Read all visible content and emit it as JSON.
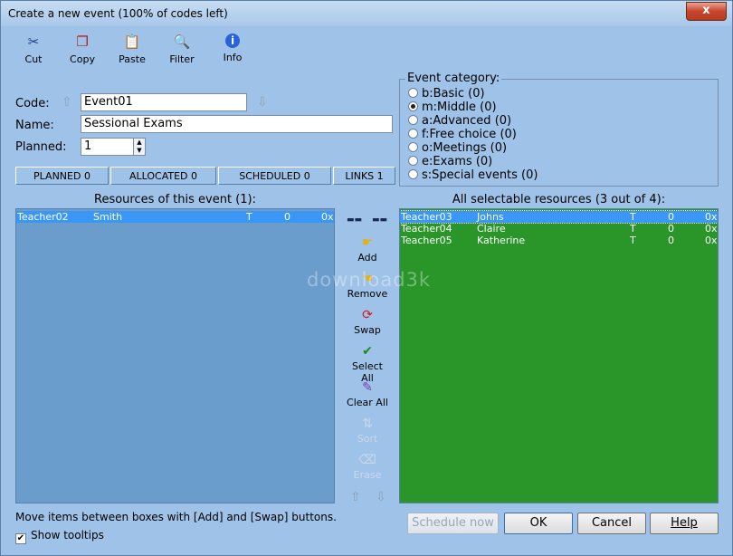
{
  "window": {
    "title": "Create a new event (100% of codes left)",
    "close_label": "x"
  },
  "toolbar": [
    {
      "label": "Cut",
      "icon": "cut-icon"
    },
    {
      "label": "Copy",
      "icon": "copy-icon"
    },
    {
      "label": "Paste",
      "icon": "paste-icon"
    },
    {
      "label": "Filter",
      "icon": "filter-icon"
    },
    {
      "label": "Info",
      "icon": "info-icon"
    }
  ],
  "form": {
    "code_label": "Code:",
    "code_value": "Event01",
    "name_label": "Name:",
    "name_value": "Sessional Exams",
    "planned_label": "Planned:",
    "planned_value": "1"
  },
  "counters": [
    "PLANNED 0",
    "ALLOCATED 0",
    "SCHEDULED 0",
    "LINKS 1"
  ],
  "category": {
    "legend": "Event category:",
    "options": [
      "b:Basic (0)",
      "m:Middle (0)",
      "a:Advanced (0)",
      "f:Free choice (0)",
      "o:Meetings (0)",
      "e:Exams (0)",
      "s:Special events (0)"
    ],
    "selected_index": 1
  },
  "left_list": {
    "title": "Resources of this event (1):",
    "rows": [
      {
        "code": "Teacher02",
        "name": "Smith",
        "type": "T",
        "num": "0",
        "x": "0x"
      }
    ]
  },
  "right_list": {
    "title": "All selectable resources (3 out of 4):",
    "rows": [
      {
        "code": "Teacher03",
        "name": "Johns",
        "type": "T",
        "num": "0",
        "x": "0x"
      },
      {
        "code": "Teacher04",
        "name": "Claire",
        "type": "T",
        "num": "0",
        "x": "0x"
      },
      {
        "code": "Teacher05",
        "name": "Katherine",
        "type": "T",
        "num": "0",
        "x": "0x"
      }
    ]
  },
  "middle_buttons": {
    "add": "Add",
    "remove": "Remove",
    "swap": "Swap",
    "select_all": "Select All",
    "clear_all": "Clear All",
    "sort": "Sort",
    "erase": "Erase"
  },
  "bottom": {
    "note": "Move items between boxes with [Add] and [Swap] buttons.",
    "show_tooltips": "Show tooltips",
    "schedule_now": "Schedule now",
    "ok": "OK",
    "cancel": "Cancel",
    "help": "Help"
  },
  "watermark": "download3k",
  "colors": {
    "left_bg": "#6a9ccc",
    "right_bg": "#2a962a",
    "selected_row": "#3b97f5"
  }
}
